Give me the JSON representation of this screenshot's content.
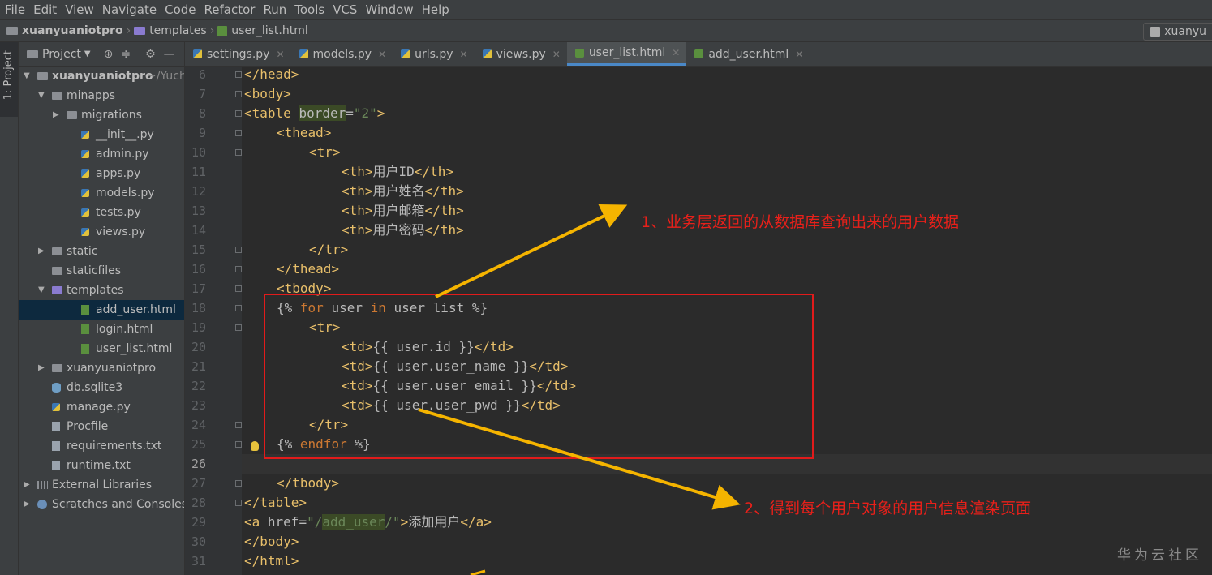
{
  "menu": [
    "File",
    "Edit",
    "View",
    "Navigate",
    "Code",
    "Refactor",
    "Run",
    "Tools",
    "VCS",
    "Window",
    "Help"
  ],
  "breadcrumb": {
    "project": "xuanyuaniotpro",
    "folder": "templates",
    "file": "user_list.html"
  },
  "run_config": "xuanyu",
  "sidebar_tab": "1: Project",
  "project_panel": {
    "title": "Project"
  },
  "tree": [
    {
      "label": "xuanyuaniotpro",
      "extra": "~/Yuchu",
      "indent": 0,
      "arrow": "down",
      "icon": "fold",
      "bold": true
    },
    {
      "label": "minapps",
      "indent": 1,
      "arrow": "down",
      "icon": "fold"
    },
    {
      "label": "migrations",
      "indent": 2,
      "arrow": "right",
      "icon": "fold"
    },
    {
      "label": "__init__.py",
      "indent": 3,
      "icon": "py"
    },
    {
      "label": "admin.py",
      "indent": 3,
      "icon": "py"
    },
    {
      "label": "apps.py",
      "indent": 3,
      "icon": "py"
    },
    {
      "label": "models.py",
      "indent": 3,
      "icon": "py"
    },
    {
      "label": "tests.py",
      "indent": 3,
      "icon": "py"
    },
    {
      "label": "views.py",
      "indent": 3,
      "icon": "py"
    },
    {
      "label": "static",
      "indent": 1,
      "arrow": "right",
      "icon": "fold"
    },
    {
      "label": "staticfiles",
      "indent": 1,
      "icon": "fold"
    },
    {
      "label": "templates",
      "indent": 1,
      "arrow": "down",
      "icon": "fold purple"
    },
    {
      "label": "add_user.html",
      "indent": 3,
      "icon": "html",
      "selected": true
    },
    {
      "label": "login.html",
      "indent": 3,
      "icon": "html"
    },
    {
      "label": "user_list.html",
      "indent": 3,
      "icon": "html"
    },
    {
      "label": "xuanyuaniotpro",
      "indent": 1,
      "arrow": "right",
      "icon": "fold"
    },
    {
      "label": "db.sqlite3",
      "indent": 1,
      "icon": "db"
    },
    {
      "label": "manage.py",
      "indent": 1,
      "icon": "py"
    },
    {
      "label": "Procfile",
      "indent": 1,
      "icon": "txt"
    },
    {
      "label": "requirements.txt",
      "indent": 1,
      "icon": "txt"
    },
    {
      "label": "runtime.txt",
      "indent": 1,
      "icon": "txt"
    },
    {
      "label": "External Libraries",
      "indent": 0,
      "arrow": "right",
      "icon": "lib"
    },
    {
      "label": "Scratches and Consoles",
      "indent": 0,
      "arrow": "right",
      "icon": "scr"
    }
  ],
  "tabs": [
    {
      "label": "settings.py",
      "icon": "py"
    },
    {
      "label": "models.py",
      "icon": "py"
    },
    {
      "label": "urls.py",
      "icon": "py"
    },
    {
      "label": "views.py",
      "icon": "py"
    },
    {
      "label": "user_list.html",
      "icon": "html",
      "active": true
    },
    {
      "label": "add_user.html",
      "icon": "html"
    }
  ],
  "code_lines": [
    {
      "n": "6",
      "html": "<span class='t'>&lt;/head&gt;</span>",
      "indent": 0
    },
    {
      "n": "7",
      "html": "<span class='t'>&lt;body&gt;</span>",
      "indent": 0
    },
    {
      "n": "8",
      "html": "<span class='t'>&lt;table </span><span class='a hl'>border</span><span class='a'>=</span><span class='av'>\"2\"</span><span class='t'>&gt;</span>",
      "indent": 0
    },
    {
      "n": "9",
      "html": "<span class='t'>&lt;thead&gt;</span>",
      "indent": 1
    },
    {
      "n": "10",
      "html": "<span class='t'>&lt;tr&gt;</span>",
      "indent": 2
    },
    {
      "n": "11",
      "html": "<span class='t'>&lt;th&gt;</span><span class='a'>用户ID</span><span class='t'>&lt;/th&gt;</span>",
      "indent": 3
    },
    {
      "n": "12",
      "html": "<span class='t'>&lt;th&gt;</span><span class='a'>用户姓名</span><span class='t'>&lt;/th&gt;</span>",
      "indent": 3
    },
    {
      "n": "13",
      "html": "<span class='t'>&lt;th&gt;</span><span class='a'>用户邮箱</span><span class='t'>&lt;/th&gt;</span>",
      "indent": 3
    },
    {
      "n": "14",
      "html": "<span class='t'>&lt;th&gt;</span><span class='a'>用户密码</span><span class='t'>&lt;/th&gt;</span>",
      "indent": 3
    },
    {
      "n": "15",
      "html": "<span class='t'>&lt;/tr&gt;</span>",
      "indent": 2
    },
    {
      "n": "16",
      "html": "<span class='t'>&lt;/thead&gt;</span>",
      "indent": 1
    },
    {
      "n": "17",
      "html": "<span class='t'>&lt;tbody&gt;</span>",
      "indent": 1
    },
    {
      "n": "18",
      "html": "<span class='a'>{% </span><span class='k'>for</span><span class='a'> user </span><span class='k'>in</span><span class='a'> user_list %}</span>",
      "indent": 1
    },
    {
      "n": "19",
      "html": "<span class='t'>&lt;tr&gt;</span>",
      "indent": 2
    },
    {
      "n": "20",
      "html": "<span class='t'>&lt;td&gt;</span><span class='a'>{{ user.id }}</span><span class='t'>&lt;/td&gt;</span>",
      "indent": 3
    },
    {
      "n": "21",
      "html": "<span class='t'>&lt;td&gt;</span><span class='a'>{{ user.user_name }}</span><span class='t'>&lt;/td&gt;</span>",
      "indent": 3
    },
    {
      "n": "22",
      "html": "<span class='t'>&lt;td&gt;</span><span class='a'>{{ user.user_email }}</span><span class='t'>&lt;/td&gt;</span>",
      "indent": 3
    },
    {
      "n": "23",
      "html": "<span class='t'>&lt;td&gt;</span><span class='a'>{{ user.user_pwd }}</span><span class='t'>&lt;/td&gt;</span>",
      "indent": 3
    },
    {
      "n": "24",
      "html": "<span class='t'>&lt;/tr&gt;</span>",
      "indent": 2
    },
    {
      "n": "25",
      "html": "<span class='a'>{% </span><span class='k'>endfor</span><span class='a'> %}</span>",
      "indent": 1
    },
    {
      "n": "26",
      "html": "",
      "indent": 0,
      "current": true
    },
    {
      "n": "27",
      "html": "<span class='t'>&lt;/tbody&gt;</span>",
      "indent": 1
    },
    {
      "n": "28",
      "html": "<span class='t'>&lt;/table&gt;</span>",
      "indent": 0
    },
    {
      "n": "29",
      "html": "<span class='t'>&lt;a </span><span class='a'>href=</span><span class='av'>\"/</span><span class='av hl'>add_user</span><span class='av'>/\"</span><span class='t'>&gt;</span><span class='a'>添加用户</span><span class='t'>&lt;/a&gt;</span>",
      "indent": 0
    },
    {
      "n": "30",
      "html": "<span class='t'>&lt;/body&gt;</span>",
      "indent": 0
    },
    {
      "n": "31",
      "html": "<span class='t'>&lt;/html&gt;</span>",
      "indent": 0
    }
  ],
  "annotations": {
    "note1": "1、业务层返回的从数据库查询出来的用户数据",
    "note2": "2、得到每个用户对象的用户信息渲染页面"
  },
  "watermark": "华为云社区",
  "colors": {
    "annotation": "#e8201a",
    "arrow": "#f5b400",
    "box": "#e11b1b"
  }
}
